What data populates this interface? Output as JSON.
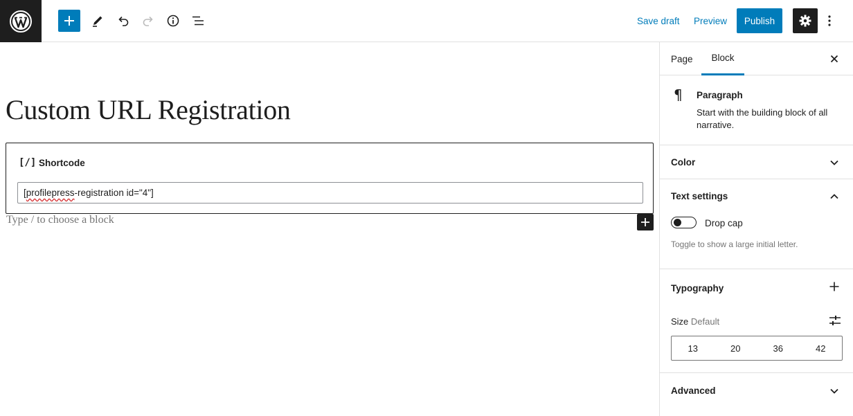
{
  "toolbar": {
    "save_draft_label": "Save draft",
    "preview_label": "Preview",
    "publish_label": "Publish"
  },
  "editor": {
    "title": "Custom URL Registration",
    "shortcode_block": {
      "icon_text": "[/]",
      "label": "Shortcode",
      "value_misspelled": "profilepress",
      "value_prefix": "[",
      "value_suffix": "-registration id=\"4\"]"
    },
    "placeholder": "Type / to choose a block"
  },
  "sidebar": {
    "tabs": [
      "Page",
      "Block"
    ],
    "active_tab": "Block",
    "block_card": {
      "icon": "paragraph-icon",
      "title": "Paragraph",
      "description": "Start with the building block of all narrative."
    },
    "panels": {
      "color": "Color",
      "text_settings": "Text settings",
      "typography": "Typography",
      "advanced": "Advanced"
    },
    "drop_cap": {
      "label": "Drop cap",
      "help": "Toggle to show a large initial letter.",
      "enabled": false
    },
    "size": {
      "label": "Size",
      "current": "Default",
      "options": [
        "13",
        "20",
        "36",
        "42"
      ]
    }
  },
  "colors": {
    "accent": "#007cba",
    "dark": "#1e1e1e",
    "muted": "#757575"
  }
}
